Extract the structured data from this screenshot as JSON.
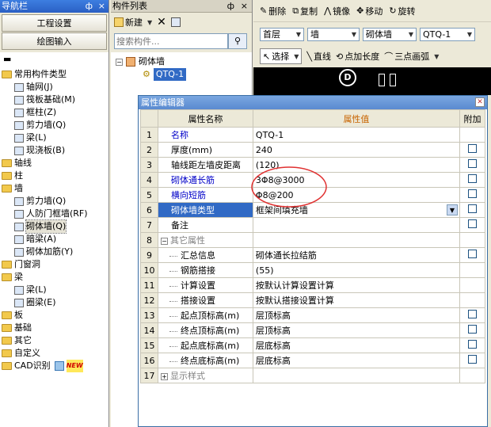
{
  "nav": {
    "title": "导航栏",
    "pin": "ф",
    "close": "×",
    "buttons": [
      "工程设置",
      "绘图输入"
    ],
    "tree": [
      {
        "label": "常用构件类型",
        "level": 0,
        "type": "folder"
      },
      {
        "label": "轴网(J)",
        "level": 1,
        "type": "item"
      },
      {
        "label": "筏板基础(M)",
        "level": 1,
        "type": "item"
      },
      {
        "label": "框柱(Z)",
        "level": 1,
        "type": "item"
      },
      {
        "label": "剪力墙(Q)",
        "level": 1,
        "type": "item"
      },
      {
        "label": "梁(L)",
        "level": 1,
        "type": "item"
      },
      {
        "label": "现浇板(B)",
        "level": 1,
        "type": "item"
      },
      {
        "label": "轴线",
        "level": 0,
        "type": "folder"
      },
      {
        "label": "柱",
        "level": 0,
        "type": "folder"
      },
      {
        "label": "墙",
        "level": 0,
        "type": "folder"
      },
      {
        "label": "剪力墙(Q)",
        "level": 1,
        "type": "item"
      },
      {
        "label": "人防门框墙(RF)",
        "level": 1,
        "type": "item"
      },
      {
        "label": "砌体墙(Q)",
        "level": 1,
        "type": "item",
        "selected": true
      },
      {
        "label": "暗梁(A)",
        "level": 1,
        "type": "item"
      },
      {
        "label": "砌体加筋(Y)",
        "level": 1,
        "type": "item"
      },
      {
        "label": "门窗洞",
        "level": 0,
        "type": "folder"
      },
      {
        "label": "梁",
        "level": 0,
        "type": "folder"
      },
      {
        "label": "梁(L)",
        "level": 1,
        "type": "item"
      },
      {
        "label": "圈梁(E)",
        "level": 1,
        "type": "item"
      },
      {
        "label": "板",
        "level": 0,
        "type": "folder"
      },
      {
        "label": "基础",
        "level": 0,
        "type": "folder"
      },
      {
        "label": "其它",
        "level": 0,
        "type": "folder"
      },
      {
        "label": "自定义",
        "level": 0,
        "type": "folder"
      },
      {
        "label": "CAD识别",
        "level": 0,
        "type": "folder",
        "badge": "NEW"
      }
    ]
  },
  "component_list": {
    "title": "构件列表",
    "new_label": "新建",
    "search_placeholder": "搜索构件...",
    "tree_root": "砌体墙",
    "tree_child": "QTQ-1"
  },
  "toolbar": {
    "delete": "删除",
    "copy": "复制",
    "mirror": "镜像",
    "move": "移动",
    "rotate": "旋转",
    "floor": "首层",
    "category": "墙",
    "subcategory": "砌体墙",
    "component": "QTQ-1",
    "select": "选择",
    "line": "直线",
    "point_length": "点加长度",
    "arc": "三点画弧"
  },
  "canvas": {
    "axis_label": "D"
  },
  "property_editor": {
    "title": "属性编辑器",
    "headers": [
      "属性名称",
      "属性值",
      "附加"
    ],
    "rows": [
      {
        "num": "1",
        "name": "名称",
        "value": "QTQ-1",
        "style": "blue",
        "check": false
      },
      {
        "num": "2",
        "name": "厚度(mm)",
        "value": "240",
        "style": "normal",
        "check": true
      },
      {
        "num": "3",
        "name": "轴线距左墙皮距离",
        "value": "(120)",
        "style": "normal",
        "check": true
      },
      {
        "num": "4",
        "name": "砌体通长筋",
        "value": "3Φ8@3000",
        "style": "blue",
        "check": true
      },
      {
        "num": "5",
        "name": "横向短筋",
        "value": "Φ8@200",
        "style": "blue",
        "check": true
      },
      {
        "num": "6",
        "name": "砌体墙类型",
        "value": "框架间填充墙",
        "style": "selected",
        "check": true
      },
      {
        "num": "7",
        "name": "备注",
        "value": "",
        "style": "normal",
        "check": true
      },
      {
        "num": "8",
        "name": "其它属性",
        "value": "",
        "style": "group",
        "check": false
      },
      {
        "num": "9",
        "name": "汇总信息",
        "value": "砌体通长拉结筋",
        "style": "child",
        "check": true
      },
      {
        "num": "10",
        "name": "钢筋搭接",
        "value": "(55)",
        "style": "child",
        "check": false
      },
      {
        "num": "11",
        "name": "计算设置",
        "value": "按默认计算设置计算",
        "style": "child",
        "check": false
      },
      {
        "num": "12",
        "name": "搭接设置",
        "value": "按默认搭接设置计算",
        "style": "child",
        "check": false
      },
      {
        "num": "13",
        "name": "起点顶标高(m)",
        "value": "层顶标高",
        "style": "child",
        "check": true
      },
      {
        "num": "14",
        "name": "终点顶标高(m)",
        "value": "层顶标高",
        "style": "child",
        "check": true
      },
      {
        "num": "15",
        "name": "起点底标高(m)",
        "value": "层底标高",
        "style": "child",
        "check": true
      },
      {
        "num": "16",
        "name": "终点底标高(m)",
        "value": "层底标高",
        "style": "child",
        "check": true
      },
      {
        "num": "17",
        "name": "显示样式",
        "value": "",
        "style": "group-collapsed",
        "check": false
      }
    ]
  },
  "colors": {
    "title_blue": "#2a5fc4",
    "header_value_text": "#c86400",
    "selected_row": "#316ac5",
    "annotation_red": "#e03030",
    "canvas_bg": "#000000"
  }
}
